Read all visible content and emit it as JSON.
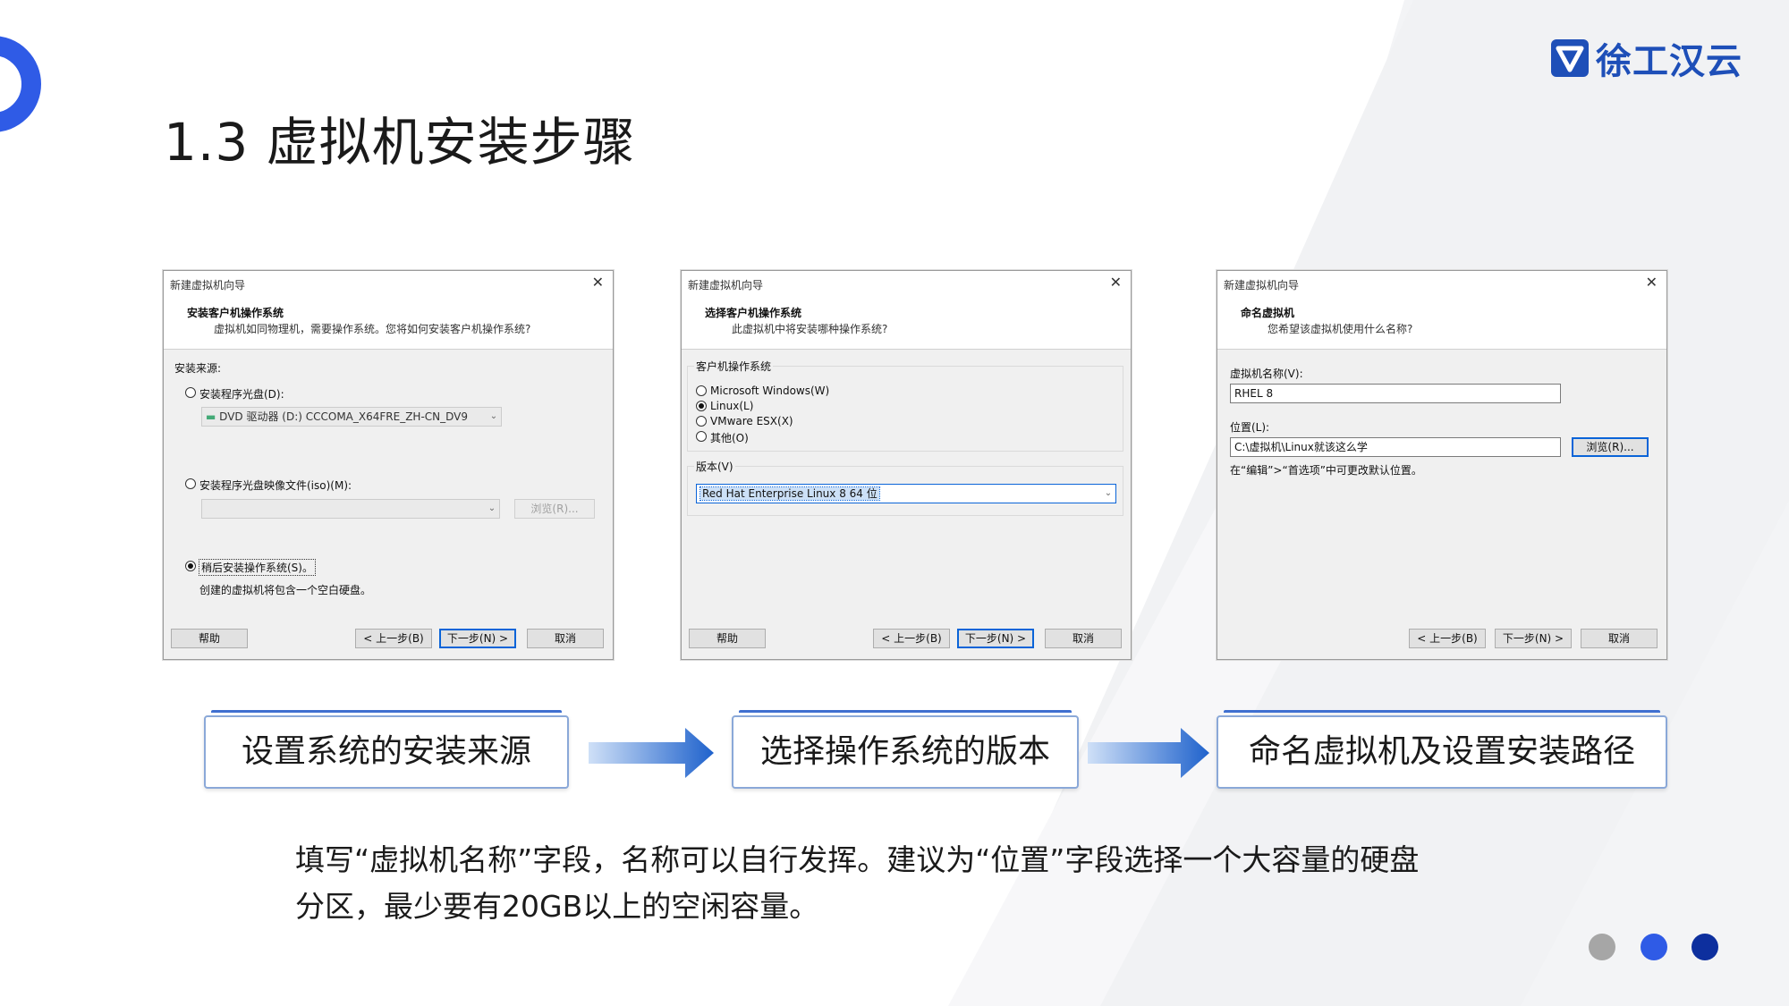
{
  "slide": {
    "title": "1.3 虚拟机安装步骤",
    "logo_text": "徐工汉云",
    "description_line1": "填写“虚拟机名称”字段，名称可以自行发挥。建议为“位置”字段选择一个大容量的硬盘",
    "description_line2": "分区，最少要有20GB以上的空闲容量。",
    "colors": {
      "accent": "#2f5be6",
      "logo": "#1e4fb8",
      "dot_gray": "#a6a6a6",
      "dot_blue": "#2f5be6",
      "dot_navy": "#0d2f9e"
    }
  },
  "dialog1": {
    "window_title": "新建虚拟机向导",
    "close": "✕",
    "heading": "安装客户机操作系统",
    "subheading": "虚拟机如同物理机，需要操作系统。您将如何安装客户机操作系统?",
    "source_label": "安装来源:",
    "opt_disc": "安装程序光盘(D):",
    "disc_value": "DVD 驱动器 (D:) CCCOMA_X64FRE_ZH-CN_DV9",
    "opt_iso": "安装程序光盘映像文件(iso)(M):",
    "iso_value": "",
    "browse": "浏览(R)...",
    "opt_later": "稍后安装操作系统(S)。",
    "later_note": "创建的虚拟机将包含一个空白硬盘。",
    "btn_help": "帮助",
    "btn_back": "< 上一步(B)",
    "btn_next": "下一步(N) >",
    "btn_cancel": "取消"
  },
  "dialog2": {
    "window_title": "新建虚拟机向导",
    "close": "✕",
    "heading": "选择客户机操作系统",
    "subheading": "此虚拟机中将安装哪种操作系统?",
    "group_os": "客户机操作系统",
    "os_options": [
      "Microsoft Windows(W)",
      "Linux(L)",
      "VMware ESX(X)",
      "其他(O)"
    ],
    "selected_os": "Linux(L)",
    "group_version": "版本(V)",
    "version_value": "Red Hat Enterprise Linux 8 64 位",
    "btn_help": "帮助",
    "btn_back": "< 上一步(B)",
    "btn_next": "下一步(N) >",
    "btn_cancel": "取消"
  },
  "dialog3": {
    "window_title": "新建虚拟机向导",
    "close": "✕",
    "heading": "命名虚拟机",
    "subheading": "您希望该虚拟机使用什么名称?",
    "name_label": "虚拟机名称(V):",
    "name_value": "RHEL 8",
    "location_label": "位置(L):",
    "location_value": "C:\\虚拟机\\Linux就该这么学",
    "browse": "浏览(R)...",
    "hint": "在“编辑”>“首选项”中可更改默认位置。",
    "btn_back": "< 上一步(B)",
    "btn_next": "下一步(N) >",
    "btn_cancel": "取消"
  },
  "steps": [
    "设置系统的安装来源",
    "选择操作系统的版本",
    "命名虚拟机及设置安装路径"
  ]
}
